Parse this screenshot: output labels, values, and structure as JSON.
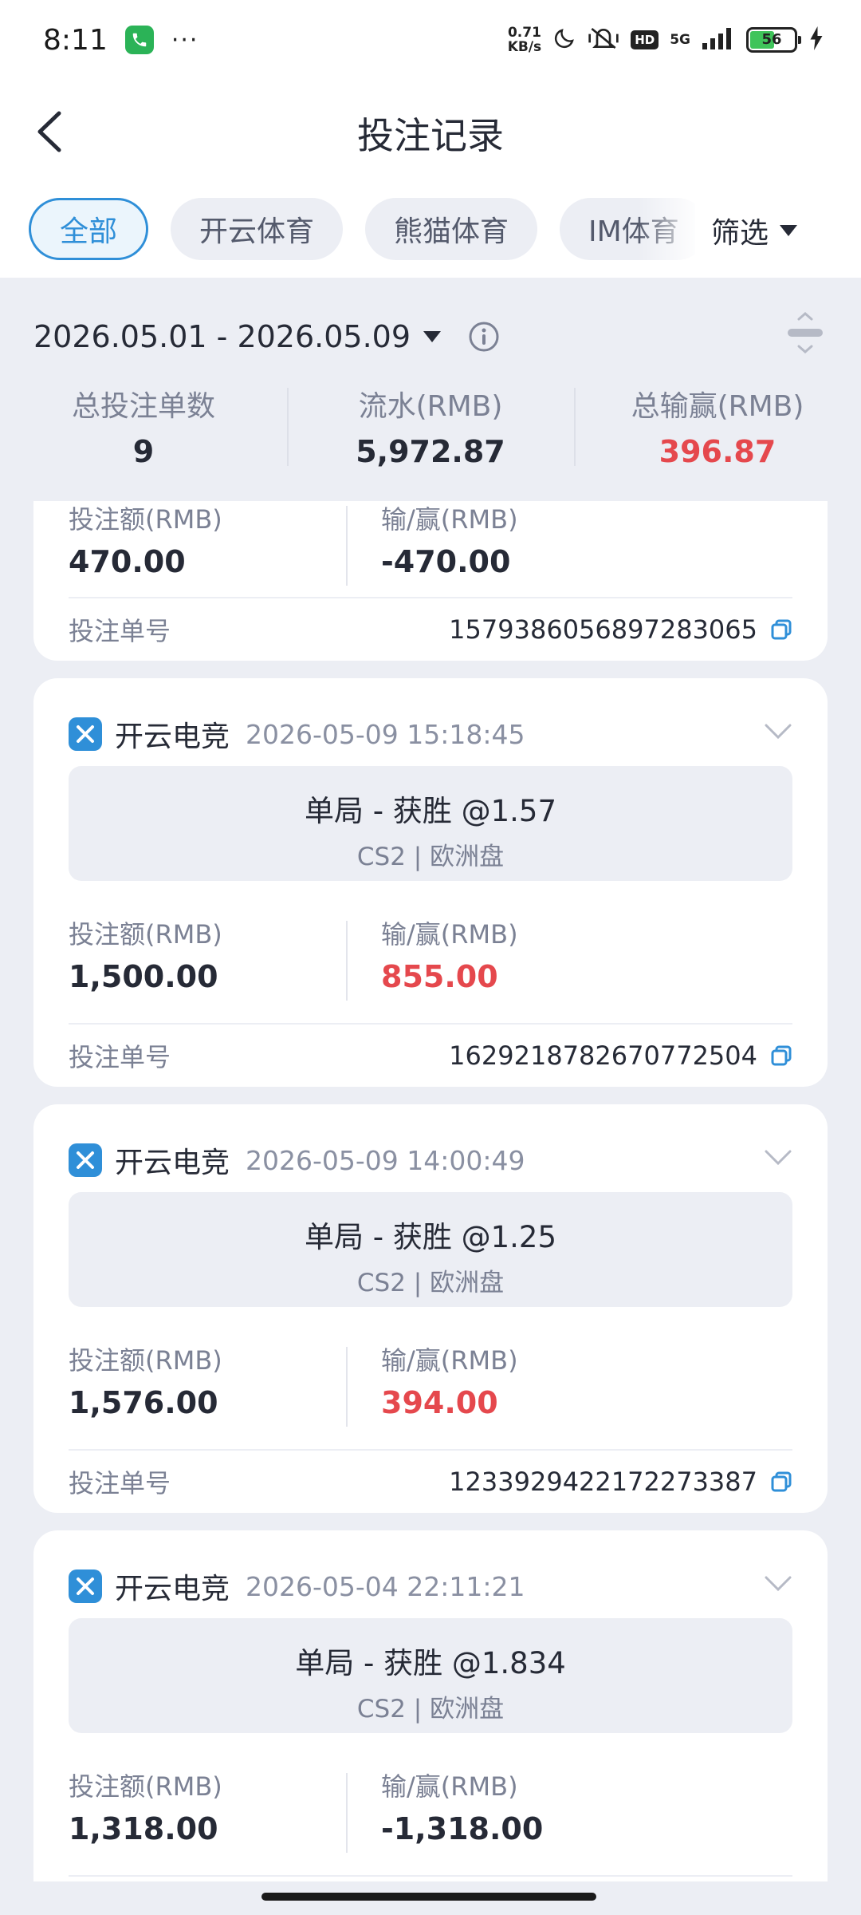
{
  "status_bar": {
    "time": "8:11",
    "dots": "···",
    "net_speed_value": "0.71",
    "net_speed_unit": "KB/s",
    "hd": "HD",
    "network": "5G",
    "battery": "56",
    "battery_level": 0.56
  },
  "header": {
    "title": "投注记录"
  },
  "tabs": {
    "items": [
      "全部",
      "开云体育",
      "熊猫体育",
      "IM体育"
    ],
    "active_index": 0,
    "filter_label": "筛选"
  },
  "date_range": "2026.05.01 - 2026.05.09",
  "summary": {
    "items": [
      {
        "label": "总投注单数",
        "value": "9"
      },
      {
        "label": "流水(RMB)",
        "value": "5,972.87"
      },
      {
        "label": "总输赢(RMB)",
        "value": "396.87"
      }
    ],
    "win_color": "#e5484d"
  },
  "bets": {
    "stake_label": "投注额(RMB)",
    "win_loss_label": "输/赢(RMB)",
    "order_label": "投注单号",
    "items": [
      {
        "stake": "470.00",
        "win_loss": "-470.00",
        "order_no": "1579386056897283065"
      },
      {
        "venue": "开云电竞",
        "time": "2026-05-09 15:18:45",
        "market": "单局 - 获胜 @1.57",
        "sub": "CS2 | 欧洲盘",
        "stake": "1,500.00",
        "win_loss": "855.00",
        "order_no": "1629218782670772504"
      },
      {
        "venue": "开云电竞",
        "time": "2026-05-09 14:00:49",
        "market": "单局 - 获胜 @1.25",
        "sub": "CS2 | 欧洲盘",
        "stake": "1,576.00",
        "win_loss": "394.00",
        "order_no": "1233929422172273387"
      },
      {
        "venue": "开云电竞",
        "time": "2026-05-04 22:11:21",
        "market": "单局 - 获胜 @1.834",
        "sub": "CS2 | 欧洲盘",
        "stake": "1,318.00",
        "win_loss": "-1,318.00"
      }
    ]
  },
  "colors": {
    "accent": "#2f8fd8",
    "win": "#e5484d",
    "background": "#eceef4"
  }
}
